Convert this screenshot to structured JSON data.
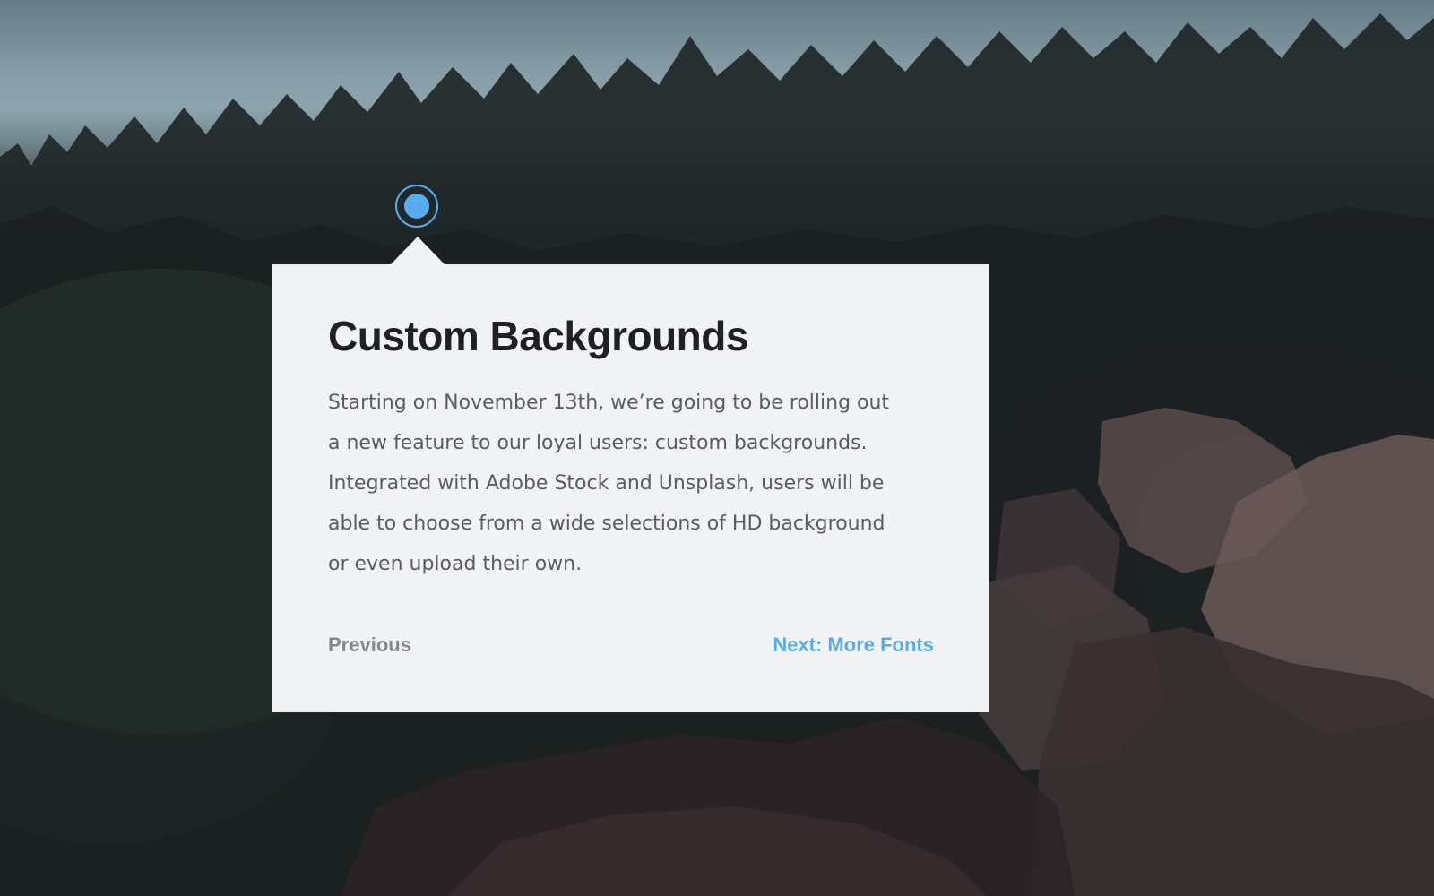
{
  "tour": {
    "title": "Custom Backgrounds",
    "description": "Starting on November 13th, we’re going to be rolling out a new feature to our loyal users: custom backgrounds. Integrated with Adobe Stock and Unsplash, users will be able to choose from a wide selections of HD background or even upload their own.",
    "previous_label": "Previous",
    "next_label": "Next: More Fonts"
  },
  "colors": {
    "accent": "#5aabee",
    "card_background": "#f2f3f5",
    "title": "#1f2022",
    "body_text": "#5a5c60",
    "previous_text": "#85878b"
  },
  "icons": {
    "hotspot": "hotspot-beacon-icon"
  }
}
